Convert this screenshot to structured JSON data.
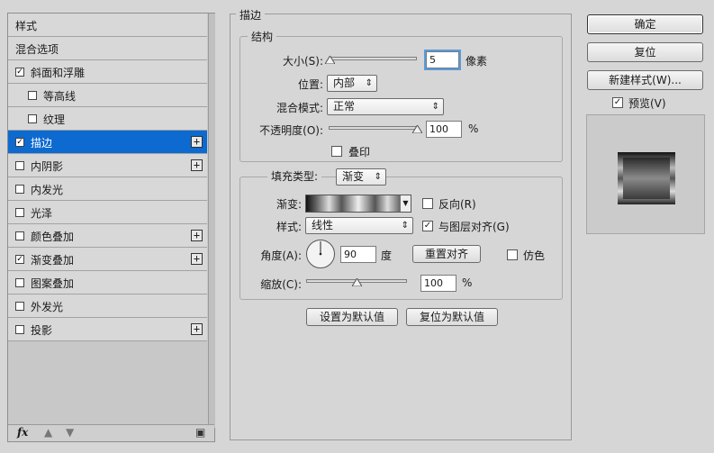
{
  "left_panel": {
    "items": [
      {
        "label": "样式",
        "checkbox": false,
        "checked": false,
        "plus": false,
        "selected": false,
        "indent": 0
      },
      {
        "label": "混合选项",
        "checkbox": false,
        "checked": false,
        "plus": false,
        "selected": false,
        "indent": 0
      },
      {
        "label": "斜面和浮雕",
        "checkbox": true,
        "checked": true,
        "plus": false,
        "selected": false,
        "indent": 0
      },
      {
        "label": "等高线",
        "checkbox": true,
        "checked": false,
        "plus": false,
        "selected": false,
        "indent": 1
      },
      {
        "label": "纹理",
        "checkbox": true,
        "checked": false,
        "plus": false,
        "selected": false,
        "indent": 1
      },
      {
        "label": "描边",
        "checkbox": true,
        "checked": true,
        "plus": true,
        "selected": true,
        "indent": 0
      },
      {
        "label": "内阴影",
        "checkbox": true,
        "checked": false,
        "plus": true,
        "selected": false,
        "indent": 0
      },
      {
        "label": "内发光",
        "checkbox": true,
        "checked": false,
        "plus": false,
        "selected": false,
        "indent": 0
      },
      {
        "label": "光泽",
        "checkbox": true,
        "checked": false,
        "plus": false,
        "selected": false,
        "indent": 0
      },
      {
        "label": "颜色叠加",
        "checkbox": true,
        "checked": false,
        "plus": true,
        "selected": false,
        "indent": 0
      },
      {
        "label": "渐变叠加",
        "checkbox": true,
        "checked": true,
        "plus": true,
        "selected": false,
        "indent": 0
      },
      {
        "label": "图案叠加",
        "checkbox": true,
        "checked": false,
        "plus": false,
        "selected": false,
        "indent": 0
      },
      {
        "label": "外发光",
        "checkbox": true,
        "checked": false,
        "plus": false,
        "selected": false,
        "indent": 0
      },
      {
        "label": "投影",
        "checkbox": true,
        "checked": false,
        "plus": true,
        "selected": false,
        "indent": 0
      }
    ],
    "footer": {
      "fx": "fx",
      "up_icon": "arrow-up-icon",
      "down_icon": "arrow-down-icon",
      "trash_icon": "trash-icon"
    }
  },
  "stroke": {
    "title": "描边",
    "structure": {
      "title": "结构",
      "size_label": "大小(S):",
      "size_value": "5",
      "size_unit": "像素",
      "size_fraction": 0.02,
      "position_label": "位置:",
      "position_value": "内部",
      "blend_label": "混合模式:",
      "blend_value": "正常",
      "opacity_label": "不透明度(O):",
      "opacity_value": "100",
      "opacity_unit": "%",
      "opacity_fraction": 1.0,
      "overprint_label": "叠印",
      "overprint_checked": false
    },
    "fill": {
      "type_label": "填充类型:",
      "type_value": "渐变",
      "gradient_label": "渐变:",
      "reverse_label": "反向(R)",
      "reverse_checked": false,
      "style_label": "样式:",
      "style_value": "线性",
      "align_label": "与图层对齐(G)",
      "align_checked": true,
      "angle_label": "角度(A):",
      "angle_value": "90",
      "angle_unit": "度",
      "reset_align_label": "重置对齐",
      "dither_label": "仿色",
      "dither_checked": false,
      "scale_label": "缩放(C):",
      "scale_value": "100",
      "scale_unit": "%",
      "scale_fraction": 0.5
    },
    "set_default_label": "设置为默认值",
    "reset_default_label": "复位为默认值"
  },
  "right": {
    "ok_label": "确定",
    "reset_label": "复位",
    "new_style_label": "新建样式(W)...",
    "preview_label": "预览(V)",
    "preview_checked": true
  },
  "colors": {
    "selected": "#0c6ad0",
    "panel": "#d6d6d6"
  }
}
